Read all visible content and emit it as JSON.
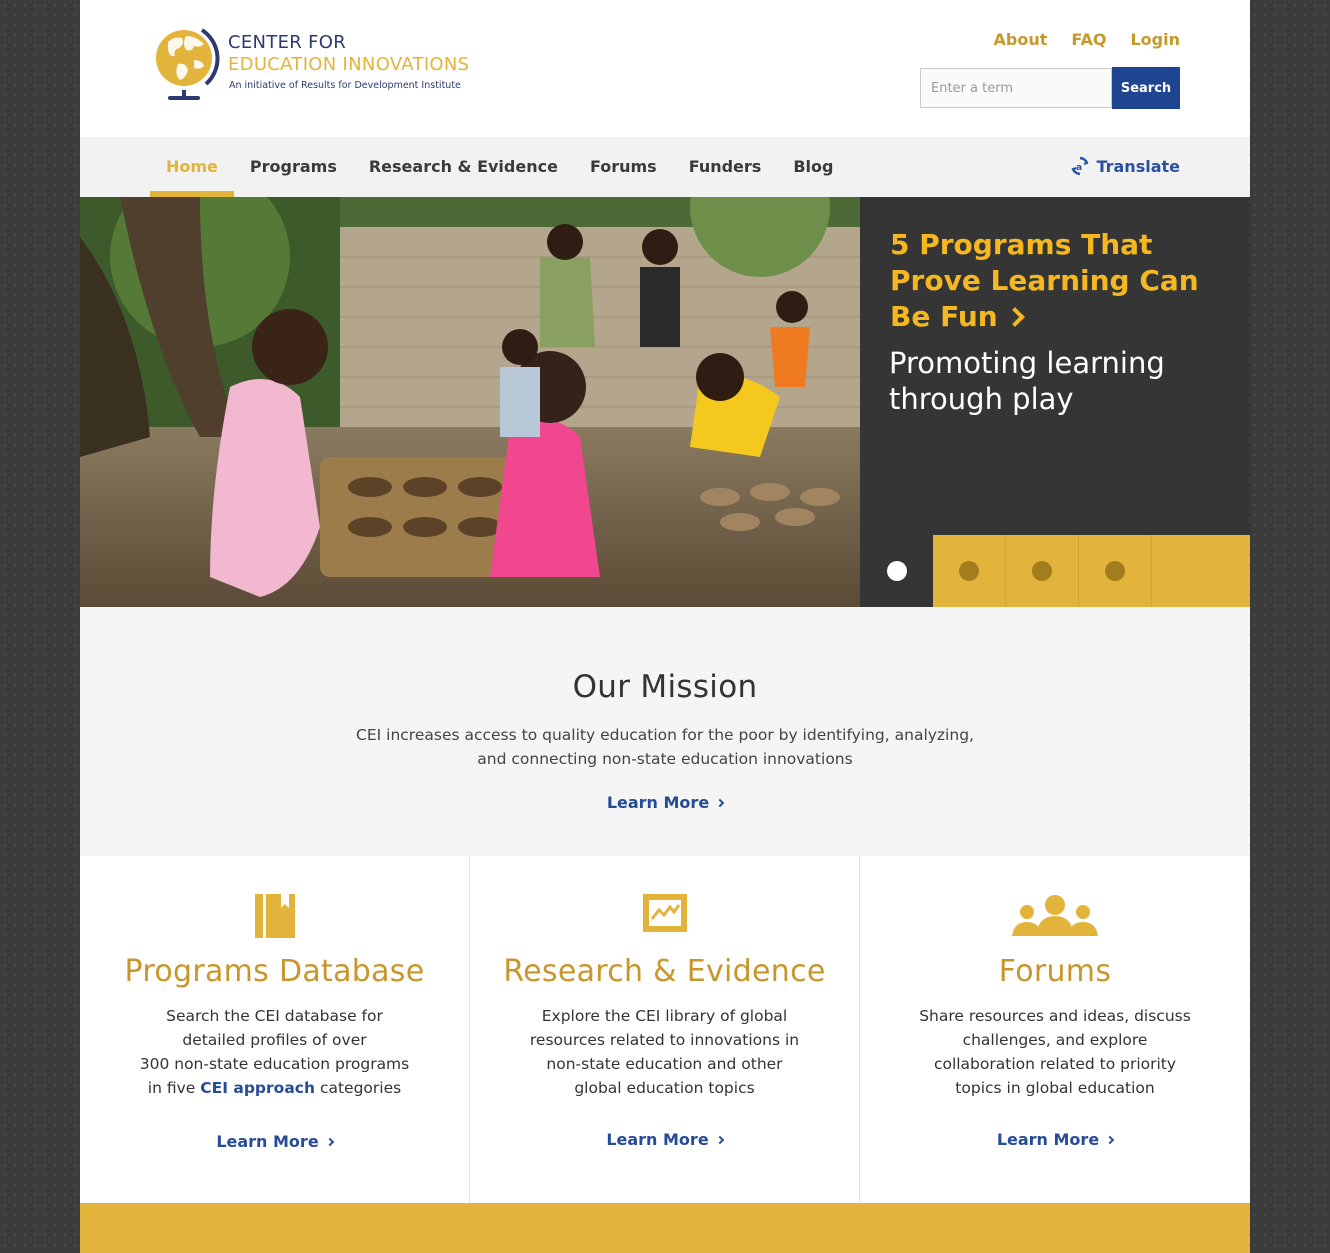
{
  "logo": {
    "line1": "CENTER FOR",
    "line2": "EDUCATION INNOVATIONS",
    "line3": "An initiative of Results for Development Institute"
  },
  "top_links": [
    "About",
    "FAQ",
    "Login"
  ],
  "search": {
    "placeholder": "Enter a term",
    "button": "Search"
  },
  "nav": {
    "items": [
      "Home",
      "Programs",
      "Research & Evidence",
      "Forums",
      "Funders",
      "Blog"
    ],
    "active": "Home",
    "translate": "Translate"
  },
  "hero": {
    "title": "5 Programs That Prove Learning Can Be Fun",
    "subtitle": "Promoting learning through play",
    "slide_count": 4,
    "active_slide": 1
  },
  "mission": {
    "title": "Our Mission",
    "text_line1": "CEI increases access to quality education for the poor by identifying, analyzing,",
    "text_line2": "and connecting non-state education innovations",
    "learn_more": "Learn More"
  },
  "columns": [
    {
      "title": "Programs Database",
      "text_lines": [
        "Search the CEI database for",
        "detailed profiles of over",
        "300 non-state education programs"
      ],
      "last_prefix": "in five ",
      "link": "CEI approach",
      "last_suffix": " categories",
      "learn_more": "Learn More",
      "icon": "book-icon"
    },
    {
      "title": "Research & Evidence",
      "text_lines": [
        "Explore the CEI library of global",
        "resources related to innovations in",
        "non-state education and other",
        "global education topics"
      ],
      "learn_more": "Learn More",
      "icon": "chart-icon"
    },
    {
      "title": "Forums",
      "text_lines": [
        "Share resources and ideas, discuss",
        "challenges, and explore",
        "collaboration related to priority",
        "topics in global education"
      ],
      "learn_more": "Learn More",
      "icon": "people-icon"
    }
  ],
  "colors": {
    "accent": "#e3b43b",
    "link_blue": "#264c97",
    "search_btn": "#1f4591",
    "hero_panel": "#353535",
    "hero_title": "#f5b820"
  }
}
